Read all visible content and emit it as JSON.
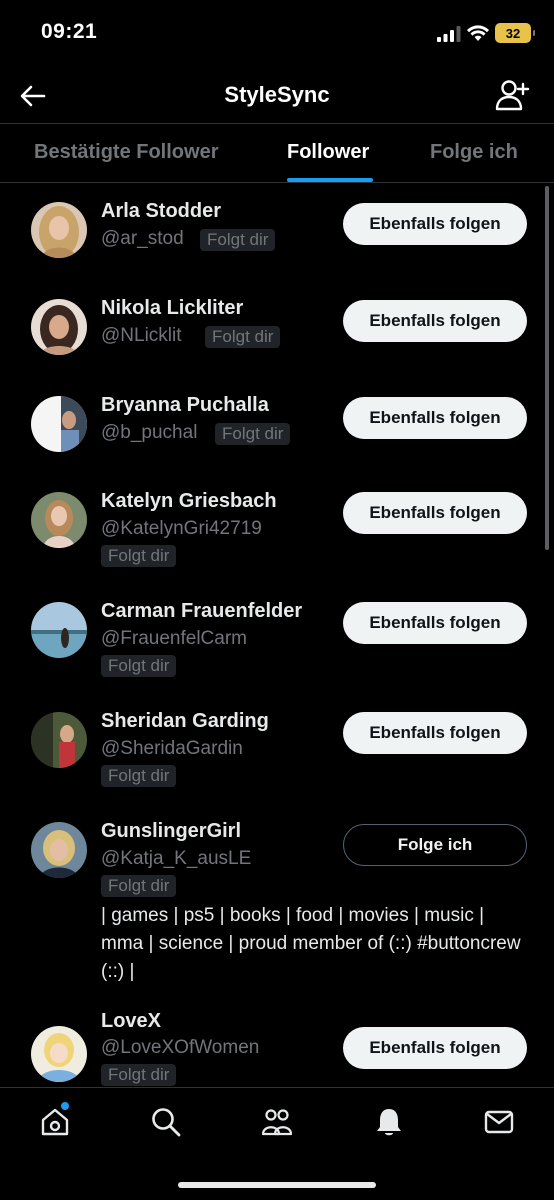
{
  "status_bar": {
    "time": "09:21",
    "battery": "32"
  },
  "header": {
    "title": "StyleSync"
  },
  "tabs": [
    {
      "label": "Bestätigte Follower",
      "active": false
    },
    {
      "label": "Follower",
      "active": true
    },
    {
      "label": "Folge ich",
      "active": false
    }
  ],
  "followers": [
    {
      "name": "Arla Stodder",
      "handle": "@ar_stod",
      "badge": "Folgt dir",
      "button": "Ebenfalls folgen"
    },
    {
      "name": "Nikola Lickliter",
      "handle": "@NLicklit",
      "badge": "Folgt dir",
      "button": "Ebenfalls folgen"
    },
    {
      "name": "Bryanna Puchalla",
      "handle": "@b_puchal",
      "badge": "Folgt dir",
      "button": "Ebenfalls folgen"
    },
    {
      "name": "Katelyn Griesbach",
      "handle": "@KatelynGri42719",
      "badge": "Folgt dir",
      "button": "Ebenfalls folgen"
    },
    {
      "name": "Carman Frauenfelder",
      "handle": "@FrauenfelCarm",
      "badge": "Folgt dir",
      "button": "Ebenfalls folgen"
    },
    {
      "name": "Sheridan Garding",
      "handle": "@SheridaGardin",
      "badge": "Folgt dir",
      "button": "Ebenfalls folgen"
    },
    {
      "name": "GunslingerGirl",
      "handle": "@Katja_K_ausLE",
      "badge": "Folgt dir",
      "button": "Folge ich",
      "bio": "| games | ps5 | books | food | movies | music | mma | science | proud member of (::) #buttoncrew (::) |"
    },
    {
      "name": "LoveX",
      "handle": "@LoveXOfWomen",
      "badge": "Folgt dir",
      "button": "Ebenfalls folgen"
    }
  ],
  "bottom_nav": [
    {
      "name": "home-icon",
      "notification_dot": true
    },
    {
      "name": "search-icon"
    },
    {
      "name": "communities-icon"
    },
    {
      "name": "notifications-icon"
    },
    {
      "name": "messages-icon"
    }
  ],
  "colors": {
    "accent": "#1d9bf0",
    "background": "#000000",
    "battery": "#e8c34a"
  }
}
